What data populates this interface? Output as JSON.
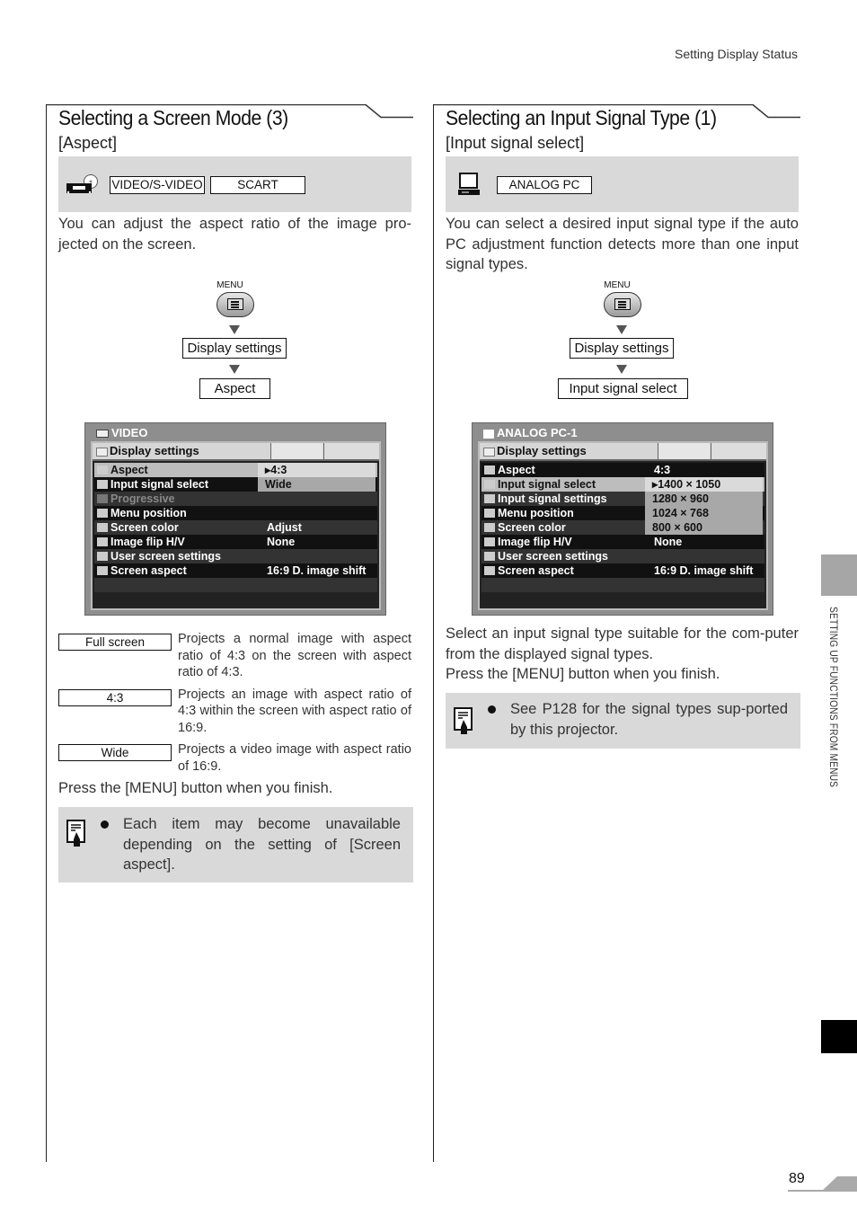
{
  "running_head": "Setting Display Status",
  "left": {
    "title": "Selecting a Screen Mode (3)",
    "subtitle": "[Aspect]",
    "input_icon": "vcr-dvd-icon",
    "input_tags": [
      "VIDEO/S-VIDEO",
      "SCART"
    ],
    "intro": "You can adjust the aspect ratio of the image pro-jected on the screen.",
    "menu_label": "MENU",
    "flow": [
      "Display settings",
      "Aspect"
    ],
    "osd": {
      "source": "VIDEO",
      "tab": "Display settings",
      "rows": [
        {
          "label": "Aspect",
          "value": ""
        },
        {
          "label": "Input signal select",
          "value": ""
        },
        {
          "label": "Progressive",
          "value": ""
        },
        {
          "label": "Menu position",
          "value": ""
        },
        {
          "label": "Screen color",
          "value": "Adjust"
        },
        {
          "label": "Image flip H/V",
          "value": "None"
        },
        {
          "label": "User screen settings",
          "value": ""
        },
        {
          "label": "Screen aspect",
          "value": "16:9 D. image shift"
        }
      ],
      "dropdown": [
        "4:3",
        "Wide"
      ],
      "dropdown_selected": "4:3"
    },
    "options": [
      {
        "key": "Full screen",
        "desc": "Projects a normal image with aspect ratio of 4:3 on the screen with aspect ratio of 4:3."
      },
      {
        "key": "4:3",
        "desc": "Projects an image with aspect ratio of 4:3 within the screen with aspect ratio of 16:9."
      },
      {
        "key": "Wide",
        "desc": "Projects a video image with aspect ratio of 16:9."
      }
    ],
    "press": "Press the [MENU] button when you finish.",
    "note": "Each item may become unavailable depending on the setting of [Screen aspect]."
  },
  "right": {
    "title": "Selecting an Input Signal Type (1)",
    "subtitle": "[Input signal select]",
    "input_icon": "computer-icon",
    "input_tags": [
      "ANALOG PC"
    ],
    "intro": "You can select a desired input signal type if the auto PC adjustment function detects more than one input signal types.",
    "menu_label": "MENU",
    "flow": [
      "Display settings",
      "Input signal select"
    ],
    "osd": {
      "source": "ANALOG PC-1",
      "tab": "Display settings",
      "rows": [
        {
          "label": "Aspect",
          "value": "4:3"
        },
        {
          "label": "Input signal select",
          "value": ""
        },
        {
          "label": "Input signal settings",
          "value": ""
        },
        {
          "label": "Menu position",
          "value": ""
        },
        {
          "label": "Screen color",
          "value": ""
        },
        {
          "label": "Image flip H/V",
          "value": "None"
        },
        {
          "label": "User screen settings",
          "value": ""
        },
        {
          "label": "Screen aspect",
          "value": "16:9 D. image shift"
        }
      ],
      "dropdown": [
        "1400 × 1050",
        "1280 × 960",
        "1024 × 768",
        "800 × 600"
      ],
      "dropdown_selected": "1400 × 1050"
    },
    "body1": "Select an input signal type suitable for the com-puter from the displayed signal types.",
    "press": "Press the [MENU] button when you finish.",
    "note": "See P128 for the signal types sup-ported by this projector."
  },
  "side_label": "SETTING UP FUNCTIONS FROM MENUS",
  "page_number": "89"
}
